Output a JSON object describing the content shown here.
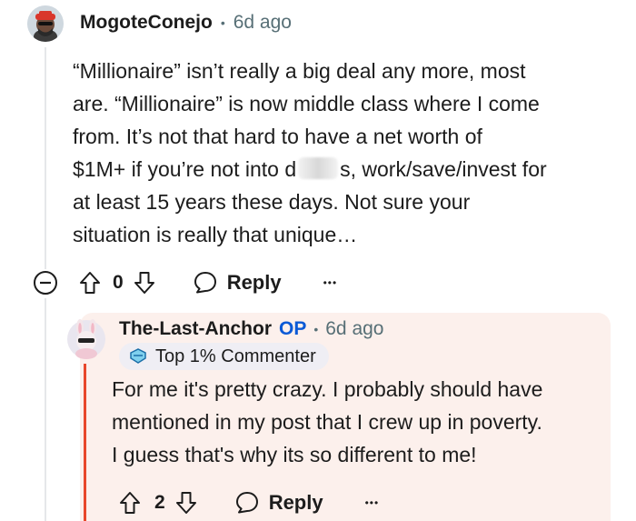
{
  "comment": {
    "username": "MogoteConejo",
    "separator": "•",
    "time": "6d ago",
    "lines": [
      "“Millionaire” isn’t really a big deal any more, most",
      "are. “Millionaire” is now middle class where I come",
      "from. It’s not that hard to have a net worth of",
      "s, work/save/invest for",
      "at least 15 years these days. Not sure your",
      "situation is really that unique…"
    ],
    "line4_prefix": "$1M+ if you’re not into d",
    "votes": "0",
    "reply_label": "Reply",
    "more_label": "•••"
  },
  "reply": {
    "username": "The-Last-Anchor",
    "op_label": "OP",
    "separator": "•",
    "time": "6d ago",
    "badge": "Top 1% Commenter",
    "lines": [
      "For me it's pretty crazy. I probably should have",
      "mentioned in my post that I crew up in poverty.",
      "I guess that's why its so different to me!"
    ],
    "votes": "2",
    "reply_label": "Reply",
    "more_label": "•••"
  },
  "colors": {
    "accent_red": "#e8472b",
    "op_blue": "#0a59d6",
    "reply_bg": "#fcf0ec"
  }
}
